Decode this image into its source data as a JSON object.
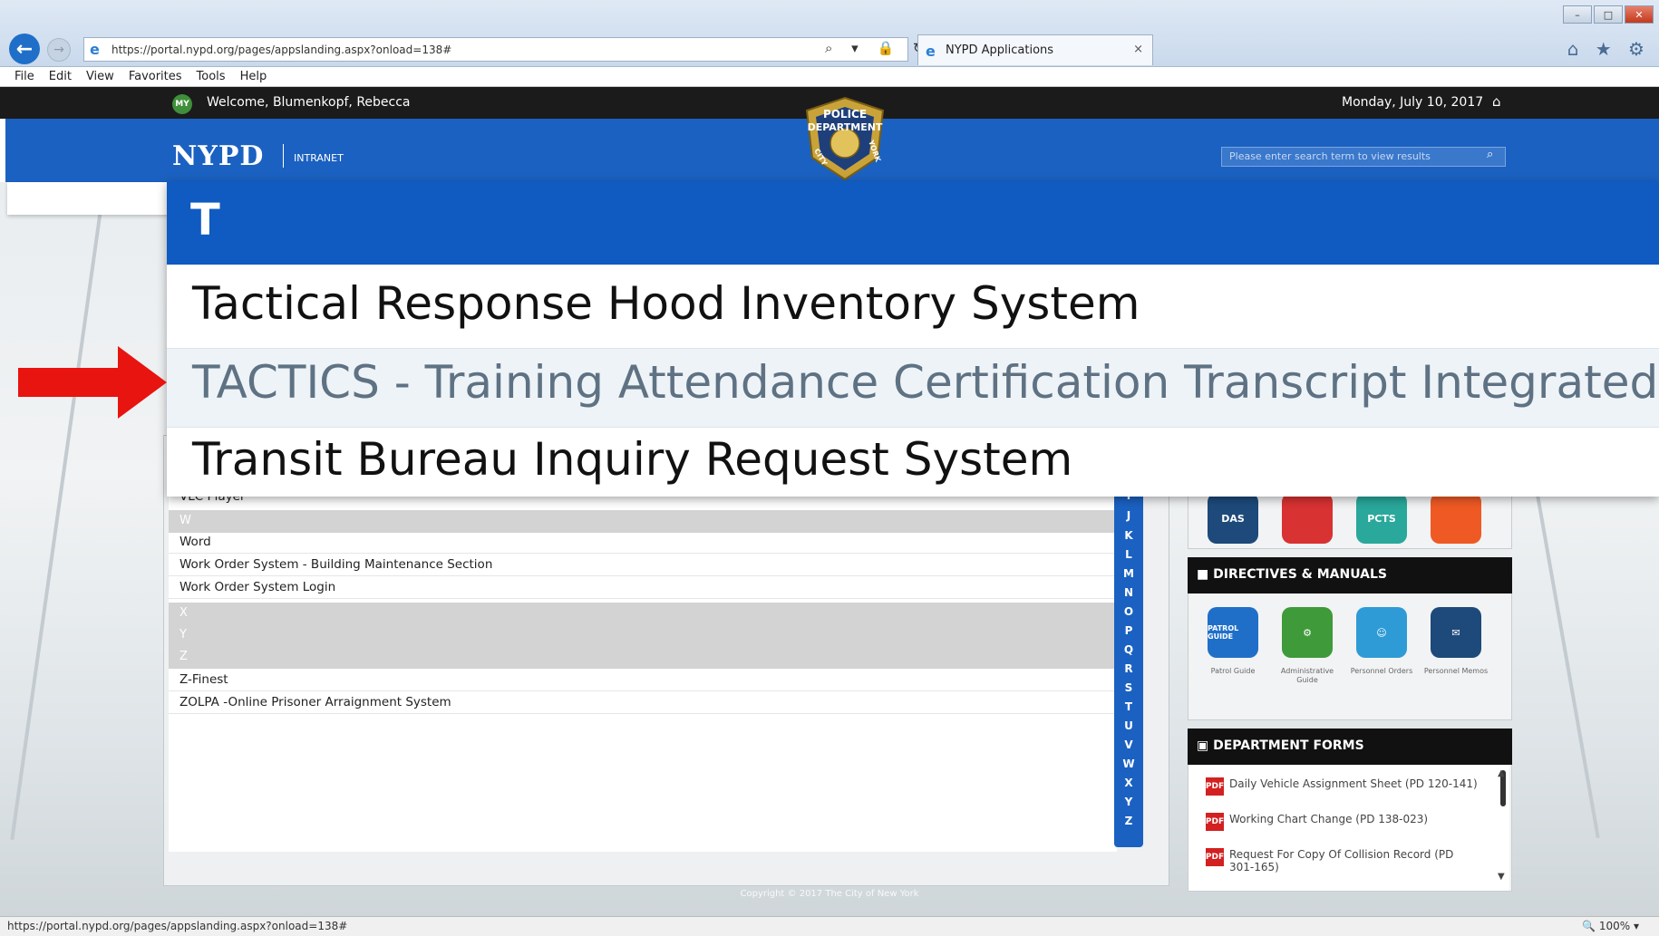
{
  "browser": {
    "url": "https://portal.nypd.org/pages/appslanding.aspx?onload=138#",
    "tab_title": "NYPD Applications",
    "tab_close": "×",
    "back_glyph": "←",
    "forward_glyph": "→",
    "address_controls": "⌕ ▾ 🔒 ↻",
    "favorite_icons": "⌂ ★ ⚙",
    "window_buttons": [
      "–",
      "□",
      "✕"
    ],
    "menu": [
      "File",
      "Edit",
      "View",
      "Favorites",
      "Tools",
      "Help"
    ],
    "status_url": "https://portal.nypd.org/pages/appslanding.aspx?onload=138#",
    "zoom": "🔍 100%  ▾"
  },
  "site": {
    "badge": "MY",
    "welcome": "Welcome, Blumenkopf, Rebecca",
    "date": "Monday, July 10, 2017",
    "logo": "NYPD",
    "intranet": "INTRANET",
    "search_placeholder": "Please enter search term to view results",
    "badge_top": "POLICE",
    "badge_mid": "DEPARTMENT",
    "badge_left": "CITY",
    "badge_right": "YORK",
    "copyright": "Copyright © 2017 The City of New York"
  },
  "overlay": {
    "letter": "T",
    "items": [
      "Tactical Response Hood Inventory System",
      "TACTICS - Training Attendance Certification Transcript Integrated Collection",
      "Transit Bureau Inquiry Request System"
    ]
  },
  "list": {
    "partial_item": "VLC Player",
    "letters": [
      "W",
      "X",
      "Y",
      "Z"
    ],
    "items": [
      "Word",
      "Work Order System - Building Maintenance Section",
      "Work Order System Login",
      "Z-Finest",
      "ZOLPA -Online Prisoner Arraignment System"
    ]
  },
  "alphabet": [
    "I",
    "J",
    "K",
    "L",
    "M",
    "N",
    "O",
    "P",
    "Q",
    "R",
    "S",
    "T",
    "U",
    "V",
    "W",
    "X",
    "Y",
    "Z"
  ],
  "apps_icons": [
    "DAS",
    "",
    "PCTS",
    ""
  ],
  "directives": {
    "title": "DIRECTIVES & MANUALS",
    "icons": [
      {
        "label": "PATROL GUIDE",
        "caption": "Patrol Guide",
        "color": "#1f6fc9"
      },
      {
        "label": "",
        "caption": "Administrative Guide",
        "color": "#3f9a3a"
      },
      {
        "label": "",
        "caption": "Personnel Orders",
        "color": "#2e9bd6"
      },
      {
        "label": "",
        "caption": "Personnel Memos",
        "color": "#1d4a7a"
      }
    ]
  },
  "forms": {
    "title": "DEPARTMENT FORMS",
    "items": [
      "Daily Vehicle Assignment Sheet (PD 120-141)",
      "Working Chart Change (PD 138-023)",
      "Request For Copy Of Collision Record (PD 301-165)"
    ]
  },
  "colors": {
    "nypd_blue": "#1b61c1",
    "arrow_red": "#e8140f",
    "highlight_text": "#5e7283"
  }
}
